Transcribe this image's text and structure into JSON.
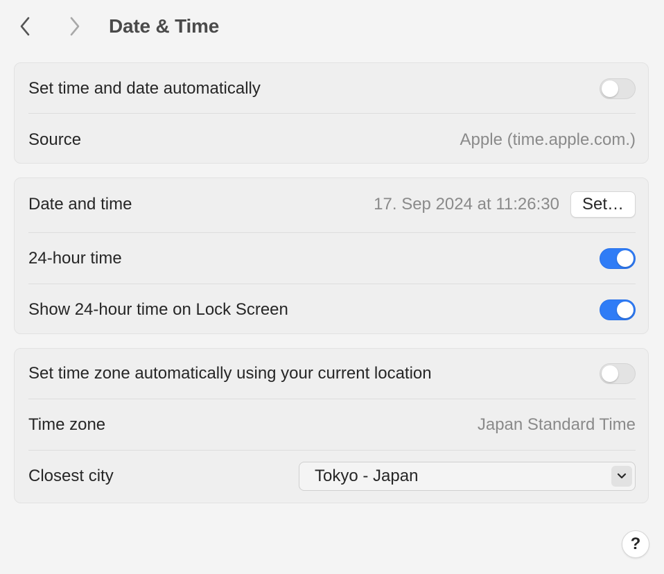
{
  "header": {
    "title": "Date & Time",
    "back_icon": "chevron-left-icon",
    "forward_icon": "chevron-right-icon"
  },
  "auto_section": {
    "set_auto_label": "Set time and date automatically",
    "set_auto_enabled": false,
    "source_label": "Source",
    "source_value": "Apple (time.apple.com.)"
  },
  "time_section": {
    "date_time_label": "Date and time",
    "date_time_value": "17. Sep 2024 at 11:26:30",
    "set_button_label": "Set…",
    "hour24_label": "24-hour time",
    "hour24_enabled": true,
    "lock_screen_label": "Show 24-hour time on Lock Screen",
    "lock_screen_enabled": true
  },
  "timezone_section": {
    "auto_tz_label": "Set time zone automatically using your current location",
    "auto_tz_enabled": false,
    "time_zone_label": "Time zone",
    "time_zone_value": "Japan Standard Time",
    "closest_city_label": "Closest city",
    "closest_city_value": "Tokyo - Japan"
  },
  "help": {
    "label": "?"
  },
  "colors": {
    "toggle_on": "#2f7cf6",
    "toggle_off": "#e3e3e3",
    "background": "#f4f4f4",
    "group_background": "#efefef"
  }
}
